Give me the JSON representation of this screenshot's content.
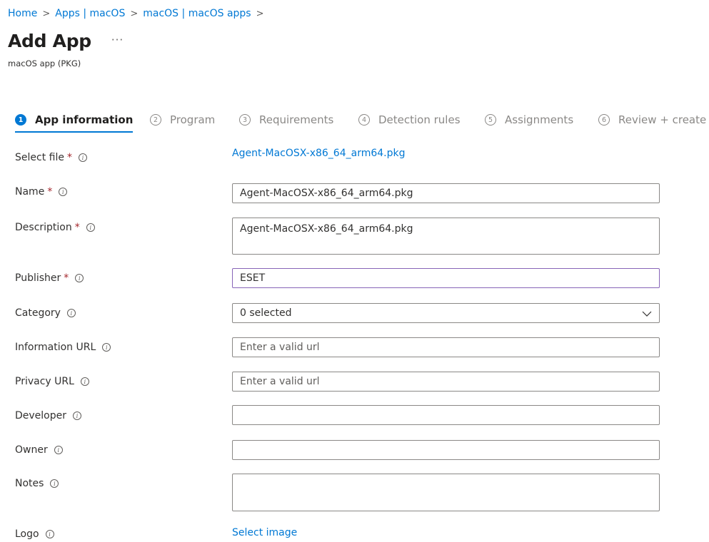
{
  "breadcrumb": [
    "Home",
    "Apps | macOS",
    "macOS | macOS apps"
  ],
  "header": {
    "title": "Add App",
    "more": "···",
    "subtitle": "macOS app (PKG)"
  },
  "steps": [
    {
      "num": "1",
      "label": "App information",
      "active": true
    },
    {
      "num": "2",
      "label": "Program"
    },
    {
      "num": "3",
      "label": "Requirements"
    },
    {
      "num": "4",
      "label": "Detection rules"
    },
    {
      "num": "5",
      "label": "Assignments"
    },
    {
      "num": "6",
      "label": "Review + create"
    }
  ],
  "form": {
    "select_file": {
      "label": "Select file",
      "value": "Agent-MacOSX-x86_64_arm64.pkg"
    },
    "name": {
      "label": "Name",
      "value": "Agent-MacOSX-x86_64_arm64.pkg"
    },
    "description": {
      "label": "Description",
      "value": "Agent-MacOSX-x86_64_arm64.pkg"
    },
    "publisher": {
      "label": "Publisher",
      "value": "ESET"
    },
    "category": {
      "label": "Category",
      "value": "0 selected"
    },
    "information_url": {
      "label": "Information URL",
      "placeholder": "Enter a valid url"
    },
    "privacy_url": {
      "label": "Privacy URL",
      "placeholder": "Enter a valid url"
    },
    "developer": {
      "label": "Developer",
      "value": ""
    },
    "owner": {
      "label": "Owner",
      "value": ""
    },
    "notes": {
      "label": "Notes",
      "value": ""
    },
    "logo": {
      "label": "Logo",
      "link": "Select image"
    }
  },
  "icons": {
    "info": "info-icon",
    "chevron": "chevron-down-icon",
    "separator": "chevron-right-icon"
  },
  "colors": {
    "accent": "#0078d4",
    "required": "#a4262c",
    "focus_border": "#8764b8"
  }
}
